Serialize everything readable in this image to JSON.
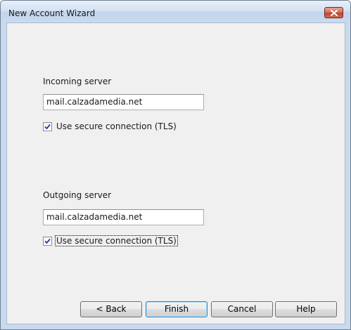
{
  "window": {
    "title": "New Account Wizard"
  },
  "incoming": {
    "label": "Incoming server",
    "server": "mail.calzadamedia.net",
    "tls_label": "Use secure connection (TLS)",
    "tls_checked": true
  },
  "outgoing": {
    "label": "Outgoing server",
    "server": "mail.calzadamedia.net",
    "tls_label": "Use secure connection (TLS)",
    "tls_checked": true
  },
  "buttons": {
    "back": "< Back",
    "finish": "Finish",
    "cancel": "Cancel",
    "help": "Help"
  },
  "icons": {
    "close": "close-icon",
    "check": "checkmark-icon"
  },
  "colors": {
    "titlebar": "#c9daee",
    "close_button": "#c2432a",
    "client_background": "#f0f0f0",
    "checkmark": "#1c3f9b"
  }
}
